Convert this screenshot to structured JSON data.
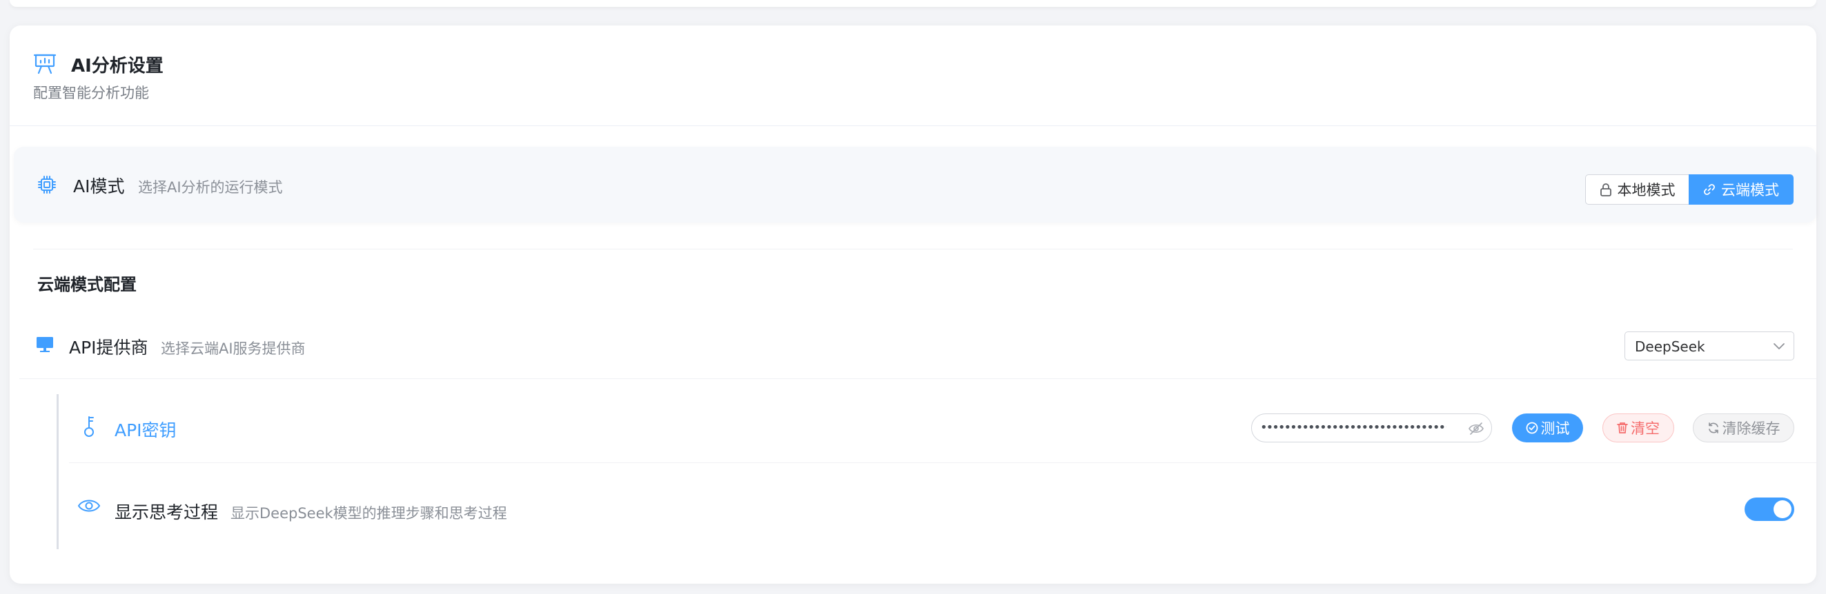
{
  "header": {
    "title": "AI分析设置",
    "subtitle": "配置智能分析功能",
    "icon": "presentation-chart-icon"
  },
  "ai_mode": {
    "title": "AI模式",
    "description": "选择AI分析的运行模式",
    "icon": "cpu-chip-icon",
    "options": [
      {
        "label": "本地模式",
        "icon": "lock-icon",
        "selected": false
      },
      {
        "label": "云端模式",
        "icon": "link-icon",
        "selected": true
      }
    ]
  },
  "cloud_config": {
    "section_title": "云端模式配置",
    "provider": {
      "title": "API提供商",
      "description": "选择云端AI服务提供商",
      "icon": "monitor-icon",
      "selected_value": "DeepSeek"
    },
    "api_key": {
      "title": "API密钥",
      "icon": "key-icon",
      "masked_value": "••••••••••••••••••••••••••••••••••••",
      "buttons": {
        "test": "测试",
        "clear": "清空",
        "clear_cache": "清除缓存"
      }
    },
    "show_thinking": {
      "title": "显示思考过程",
      "description": "显示DeepSeek模型的推理步骤和思考过程",
      "icon": "eye-icon",
      "enabled": true
    }
  },
  "colors": {
    "accent": "#409eff",
    "danger": "#f56c6c",
    "muted": "#909399"
  }
}
